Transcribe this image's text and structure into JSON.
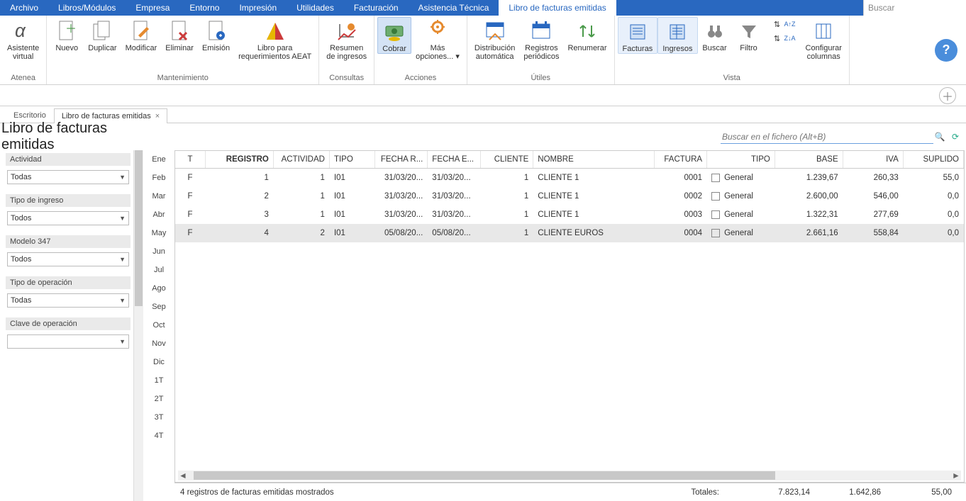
{
  "menu": {
    "items": [
      "Archivo",
      "Libros/Módulos",
      "Empresa",
      "Entorno",
      "Impresión",
      "Utilidades",
      "Facturación",
      "Asistencia Técnica",
      "Libro de facturas emitidas"
    ],
    "active_index": 8,
    "search_placeholder": "Buscar"
  },
  "ribbon": {
    "groups": {
      "atenea": {
        "label": "Atenea",
        "asistente": "Asistente\nvirtual"
      },
      "mantenimiento": {
        "label": "Mantenimiento",
        "nuevo": "Nuevo",
        "duplicar": "Duplicar",
        "modificar": "Modificar",
        "eliminar": "Eliminar",
        "emision": "Emisión",
        "libro": "Libro para\nrequerimientos AEAT"
      },
      "consultas": {
        "label": "Consultas",
        "resumen": "Resumen\nde ingresos"
      },
      "acciones": {
        "label": "Acciones",
        "cobrar": "Cobrar",
        "mas": "Más\nopciones... ▾"
      },
      "utiles": {
        "label": "Útiles",
        "dist": "Distribución\nautomática",
        "reg": "Registros\nperiódicos",
        "renum": "Renumerar"
      },
      "vista": {
        "label": "Vista",
        "facturas": "Facturas",
        "ingresos": "Ingresos",
        "buscar": "Buscar",
        "filtro": "Filtro",
        "orden_asc": "A↑Z",
        "orden_desc": "Z↓A",
        "config": "Configurar\ncolumnas"
      }
    }
  },
  "tabs": {
    "escritorio": "Escritorio",
    "libro": "Libro de facturas emitidas"
  },
  "page": {
    "title": "Libro de facturas emitidas",
    "search_placeholder": "Buscar en el fichero (Alt+B)"
  },
  "filters": {
    "actividad": {
      "label": "Actividad",
      "value": "Todas"
    },
    "tipo_ingreso": {
      "label": "Tipo de ingreso",
      "value": "Todos"
    },
    "modelo347": {
      "label": "Modelo 347",
      "value": "Todos"
    },
    "tipo_operacion": {
      "label": "Tipo de operación",
      "value": "Todas"
    },
    "clave_operacion": {
      "label": "Clave de operación",
      "value": ""
    }
  },
  "months": [
    "Ene",
    "Feb",
    "Mar",
    "Abr",
    "May",
    "Jun",
    "Jul",
    "Ago",
    "Sep",
    "Oct",
    "Nov",
    "Dic",
    "1T",
    "2T",
    "3T",
    "4T"
  ],
  "table": {
    "headers": [
      "T",
      "REGISTRO",
      "ACTIVIDAD",
      "TIPO",
      "FECHA R...",
      "FECHA E...",
      "CLIENTE",
      "NOMBRE",
      "FACTURA",
      "TIPO",
      "BASE",
      "IVA",
      "SUPLIDO"
    ],
    "rows": [
      {
        "t": "F",
        "registro": "1",
        "actividad": "1",
        "tipo": "I01",
        "fr": "31/03/20...",
        "fe": "31/03/20...",
        "cliente": "1",
        "nombre": "CLIENTE 1",
        "factura": "0001",
        "tipo2": "General",
        "base": "1.239,67",
        "iva": "260,33",
        "suplido": "55,0"
      },
      {
        "t": "F",
        "registro": "2",
        "actividad": "1",
        "tipo": "I01",
        "fr": "31/03/20...",
        "fe": "31/03/20...",
        "cliente": "1",
        "nombre": "CLIENTE 1",
        "factura": "0002",
        "tipo2": "General",
        "base": "2.600,00",
        "iva": "546,00",
        "suplido": "0,0"
      },
      {
        "t": "F",
        "registro": "3",
        "actividad": "1",
        "tipo": "I01",
        "fr": "31/03/20...",
        "fe": "31/03/20...",
        "cliente": "1",
        "nombre": "CLIENTE 1",
        "factura": "0003",
        "tipo2": "General",
        "base": "1.322,31",
        "iva": "277,69",
        "suplido": "0,0"
      },
      {
        "t": "F",
        "registro": "4",
        "actividad": "2",
        "tipo": "I01",
        "fr": "05/08/20...",
        "fe": "05/08/20...",
        "cliente": "1",
        "nombre": "CLIENTE EUROS",
        "factura": "0004",
        "tipo2": "General",
        "base": "2.661,16",
        "iva": "558,84",
        "suplido": "0,0"
      }
    ],
    "selected_index": 3
  },
  "footer": {
    "status": "4 registros de facturas emitidas mostrados",
    "totales_label": "Totales:",
    "base": "7.823,14",
    "iva": "1.642,86",
    "suplido": "55,00"
  }
}
